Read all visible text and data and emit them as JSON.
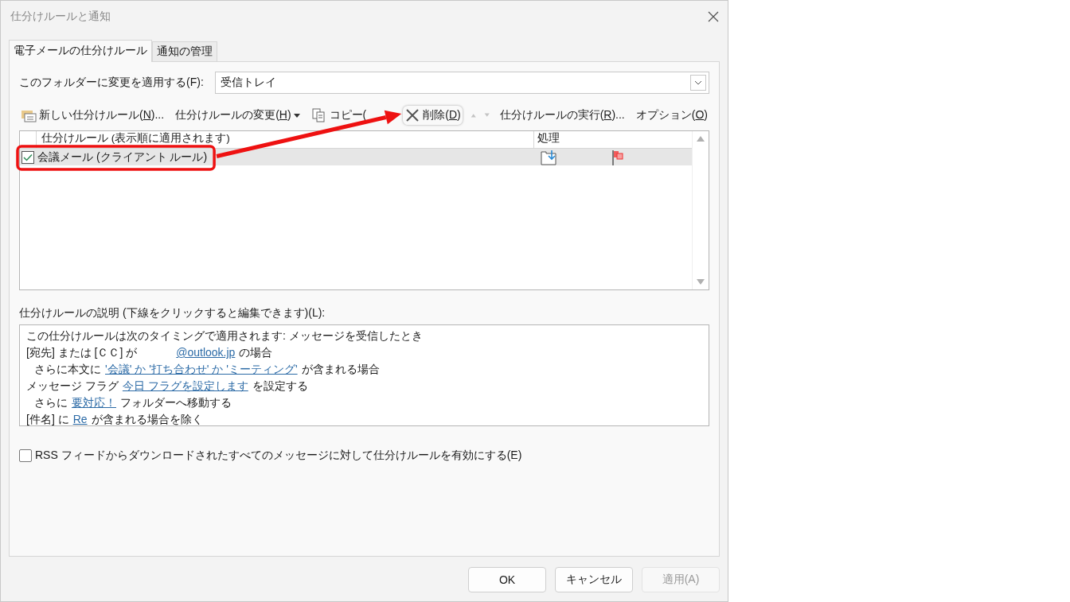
{
  "window": {
    "title": "仕分けルールと通知"
  },
  "tabs": [
    {
      "label": "電子メールの仕分けルール",
      "selected": true
    },
    {
      "label": "通知の管理",
      "selected": false
    }
  ],
  "folder": {
    "label": "このフォルダーに変更を適用する(F):",
    "value": "受信トレイ"
  },
  "toolbar": [
    {
      "kind": "new",
      "pre": "新しい仕分けルール(",
      "key": "N",
      "post": ")...",
      "disabled": false,
      "highlighted": false
    },
    {
      "kind": "change",
      "pre": "仕分けルールの変更(",
      "key": "H",
      "post": ")",
      "disabled": false,
      "highlighted": false
    },
    {
      "kind": "copy",
      "pre": "コピー(",
      "disabled": false,
      "highlighted": false
    },
    {
      "kind": "delete",
      "pre": "削除(",
      "key": "D",
      "post": ")",
      "disabled": false,
      "highlighted": true
    },
    {
      "kind": "up",
      "disabled": true,
      "highlighted": false
    },
    {
      "kind": "down",
      "disabled": true,
      "highlighted": false
    },
    {
      "kind": "run",
      "pre": "仕分けルールの実行(",
      "key": "R",
      "post": ")...",
      "disabled": false,
      "highlighted": false
    },
    {
      "kind": "options",
      "pre": "オプション(",
      "key": "O",
      "post": ")",
      "disabled": false,
      "highlighted": false
    }
  ],
  "rules_table": {
    "columns": [
      "仕分けルール (表示順に適用されます)",
      "処理"
    ],
    "rows": [
      {
        "name": "会議メール (クライアント ルール)",
        "checked": true,
        "selected": true,
        "highlighted": true
      }
    ]
  },
  "description": {
    "label": "仕分けルールの説明 (下線をクリックすると編集できます)(L):",
    "lines": [
      {
        "indent": false,
        "parts": [
          {
            "text": "この仕分けルールは次のタイミングで適用されます: メッセージを受信したとき",
            "link": false
          }
        ]
      },
      {
        "indent": false,
        "parts": [
          {
            "text": "[宛先] または [ＣＣ] が",
            "link": false
          },
          {
            "text": "@outlook.jp",
            "link": true,
            "gap": true
          },
          {
            "text": "の場合",
            "link": false
          }
        ]
      },
      {
        "indent": true,
        "parts": [
          {
            "text": "さらに本文に",
            "link": false
          },
          {
            "text": "'会議' か '打ち合わせ' か 'ミーティング'",
            "link": true
          },
          {
            "text": "が含まれる場合",
            "link": false
          }
        ]
      },
      {
        "indent": false,
        "parts": [
          {
            "text": "メッセージ フラグ",
            "link": false
          },
          {
            "text": "今日 フラグを設定します",
            "link": true
          },
          {
            "text": "を設定する",
            "link": false
          }
        ]
      },
      {
        "indent": true,
        "parts": [
          {
            "text": "さらに",
            "link": false
          },
          {
            "text": "要対応！",
            "link": true
          },
          {
            "text": "フォルダーへ移動する",
            "link": false
          }
        ]
      },
      {
        "indent": false,
        "parts": [
          {
            "text": "[件名] に",
            "link": false
          },
          {
            "text": "Re",
            "link": true
          },
          {
            "text": "が含まれる場合を除く",
            "link": false
          }
        ]
      }
    ]
  },
  "rss": {
    "label": "RSS フィードからダウンロードされたすべてのメッセージに対して仕分けルールを有効にする(E)",
    "checked": false
  },
  "buttons": [
    {
      "label": "OK",
      "disabled": false
    },
    {
      "label": "キャンセル",
      "disabled": false
    },
    {
      "label": "適用(A)",
      "disabled": true
    }
  ]
}
